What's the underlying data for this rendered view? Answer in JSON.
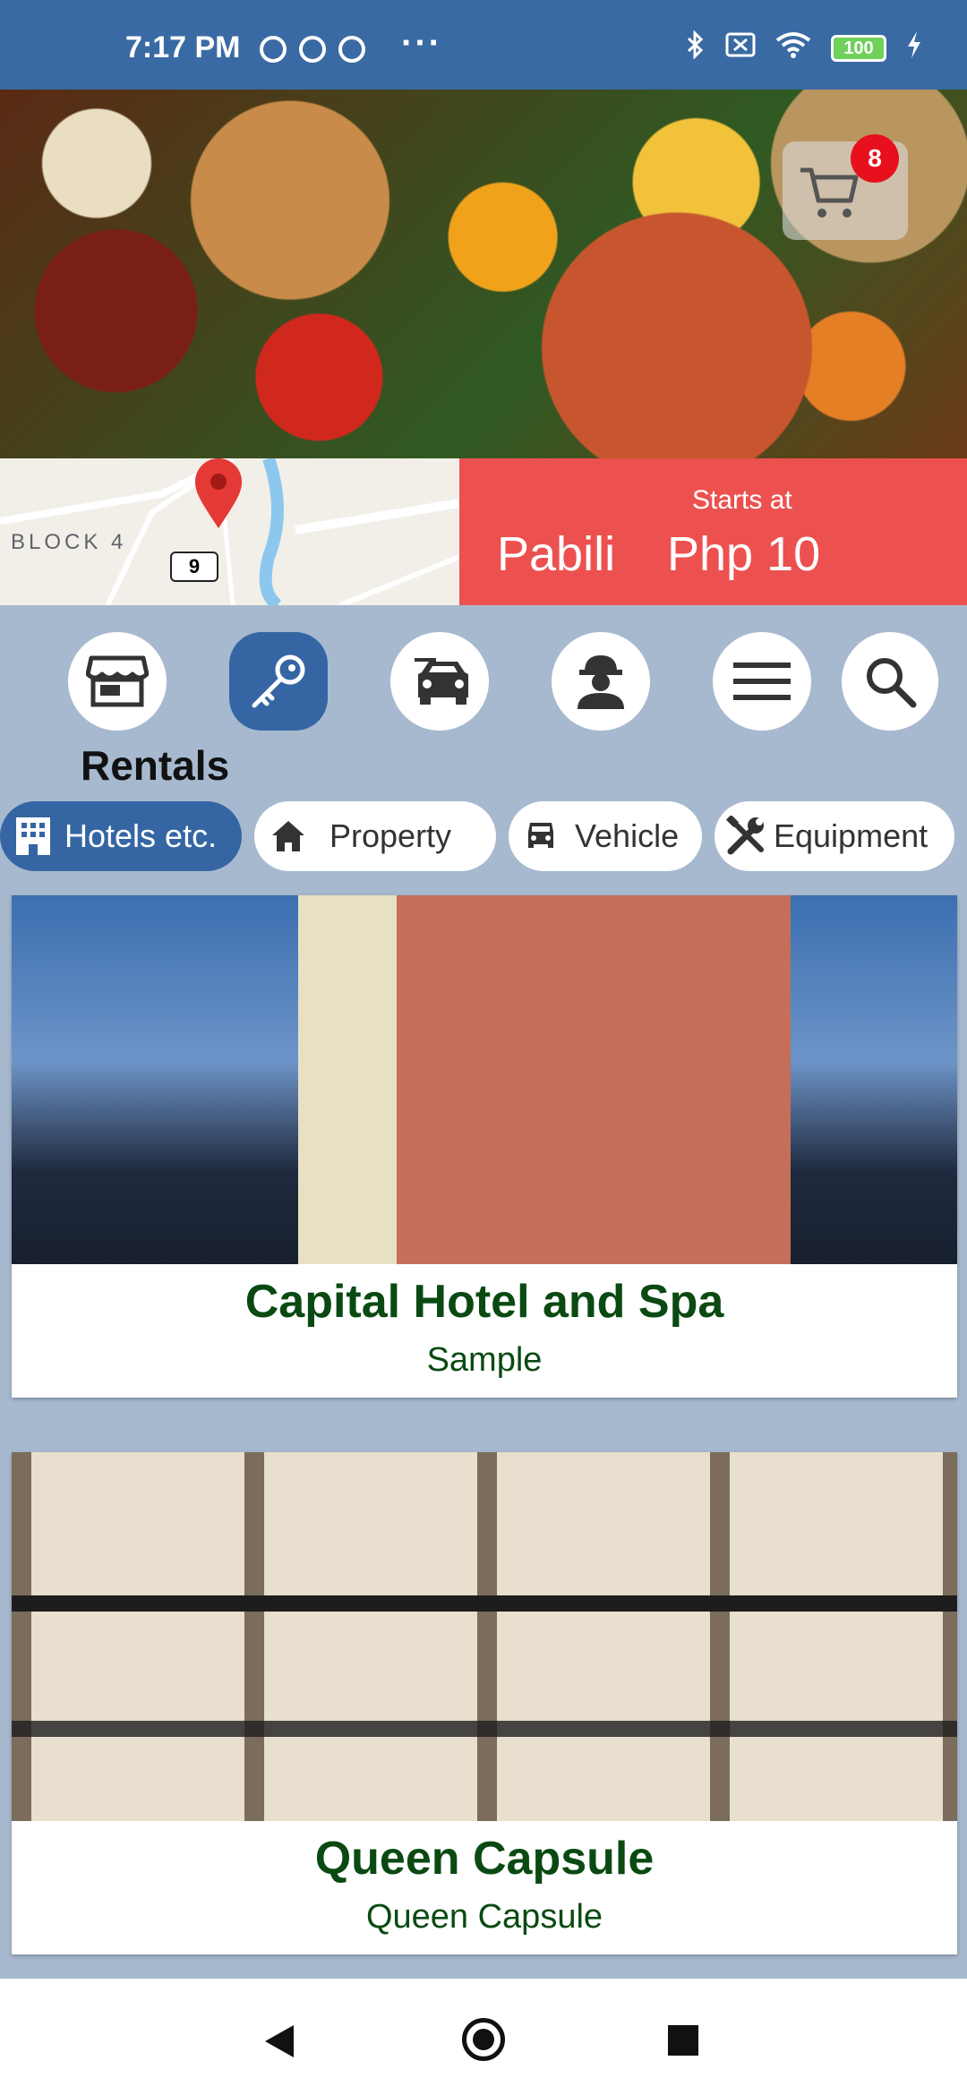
{
  "status_bar": {
    "time": "7:17 PM",
    "dots": "···",
    "battery": "100"
  },
  "header": {
    "cart_count": "8"
  },
  "map": {
    "label": "BLOCK 4",
    "road_number": "9"
  },
  "promo": {
    "starts_at": "Starts at",
    "name": "Pabili",
    "price": "Php 10"
  },
  "category_icons": [
    "store-icon",
    "key-icon",
    "car-icon",
    "worker-icon",
    "menu-icon",
    "search-icon"
  ],
  "section": {
    "title": "Rentals"
  },
  "chips": [
    {
      "label": "Hotels etc.",
      "icon": "building-icon",
      "active": true
    },
    {
      "label": "Property",
      "icon": "house-icon",
      "active": false
    },
    {
      "label": "Vehicle",
      "icon": "car-icon",
      "active": false
    },
    {
      "label": "Equipment",
      "icon": "tools-icon",
      "active": false
    }
  ],
  "listings": [
    {
      "title": "Capital Hotel and Spa",
      "subtitle": "Sample"
    },
    {
      "title": "Queen Capsule",
      "subtitle": "Queen Capsule"
    }
  ],
  "colors": {
    "status_bar": "#3a6aa3",
    "accent": "#3566a3",
    "promo": "#ec5150",
    "page_bg": "#a7b9cf",
    "title_green": "#0a4a12",
    "badge_red": "#e8101c"
  }
}
